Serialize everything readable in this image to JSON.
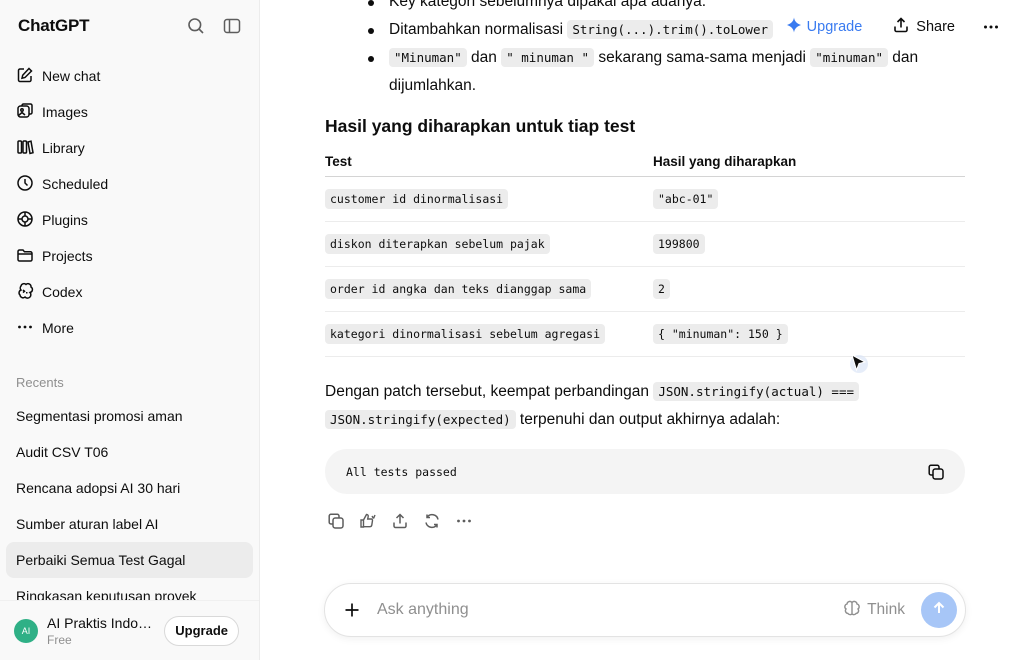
{
  "sidebar": {
    "brand": "ChatGPT",
    "nav": [
      {
        "label": "New chat",
        "icon": "new-chat-icon"
      },
      {
        "label": "Images",
        "icon": "images-icon"
      },
      {
        "label": "Library",
        "icon": "library-icon"
      },
      {
        "label": "Scheduled",
        "icon": "clock-icon"
      },
      {
        "label": "Plugins",
        "icon": "plugins-icon"
      },
      {
        "label": "Projects",
        "icon": "folder-icon"
      },
      {
        "label": "Codex",
        "icon": "codex-icon"
      },
      {
        "label": "More",
        "icon": "more-dots-icon"
      }
    ],
    "recents_label": "Recents",
    "recents": [
      "Segmentasi promosi aman",
      "Audit CSV T06",
      "Rencana adopsi AI 30 hari",
      "Sumber aturan label AI",
      "Perbaiki Semua Test Gagal",
      "Ringkasan keputusan proyek"
    ],
    "active_recent_index": 4,
    "user": {
      "initials": "AI",
      "name": "AI Praktis Indon...",
      "plan": "Free",
      "upgrade_label": "Upgrade"
    }
  },
  "header": {
    "upgrade_label": "Upgrade",
    "share_label": "Share",
    "upgrade_color": "#3a7bf0"
  },
  "message": {
    "bullets": [
      {
        "text_before": "Key kategori sebelumnya dipakai apa adanya."
      },
      {
        "text_before": "Ditambahkan normalisasi ",
        "code": "String(...).trim().toLower"
      },
      {
        "code1": "\"Minuman\"",
        "mid1": " dan ",
        "code2": "\" minuman \"",
        "mid2": " sekarang sama-sama menjadi ",
        "code3": "\"minuman\"",
        "tail": " dan dijumlahkan."
      }
    ],
    "heading": "Hasil yang diharapkan untuk tiap test",
    "table": {
      "headers": [
        "Test",
        "Hasil yang diharapkan"
      ],
      "rows": [
        [
          "customer id dinormalisasi",
          "\"abc-01\""
        ],
        [
          "diskon diterapkan sebelum pajak",
          "199800"
        ],
        [
          "order id angka dan teks dianggap sama",
          "2"
        ],
        [
          "kategori dinormalisasi sebelum agregasi",
          "{ \"minuman\": 150 }"
        ]
      ]
    },
    "para_before": "Dengan patch tersebut, keempat perbandingan ",
    "para_code1": "JSON.stringify(actual) ===",
    "para_code2": "JSON.stringify(expected)",
    "para_after": " terpenuhi dan output akhirnya adalah:",
    "output": "All tests passed"
  },
  "composer": {
    "placeholder": "Ask anything",
    "think_label": "Think"
  }
}
